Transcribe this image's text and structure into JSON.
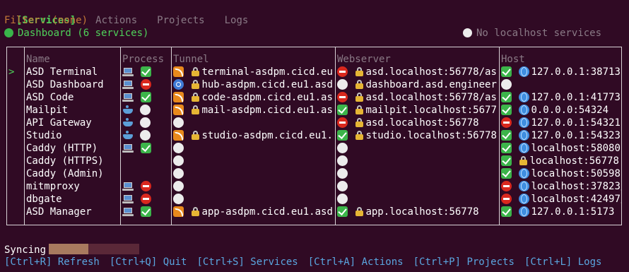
{
  "nav": {
    "tabs": [
      "[Services]",
      "Actions",
      "Projects",
      "Logs"
    ]
  },
  "filter": {
    "text": "Filter: (none)"
  },
  "project": {
    "label": "Dashboard (6 services)"
  },
  "localhost": {
    "label": "No localhost services"
  },
  "table": {
    "headers": {
      "name": "Name",
      "process": "Process",
      "tunnel": "Tunnel",
      "webserver": "Webserver",
      "host": "Host"
    },
    "selected_marker": ">",
    "rows": [
      {
        "name": "ASD Terminal",
        "tunnel": "terminal-asdpm.cicd.eu…",
        "webserver": "asd.localhost:56778/as…",
        "host": "127.0.0.1:38713"
      },
      {
        "name": "ASD Dashboard",
        "tunnel": "hub-asdpm.cicd.eu1.asd…",
        "webserver": "dashboard.asd.engineer…",
        "host": ""
      },
      {
        "name": "ASD Code",
        "tunnel": "code-asdpm.cicd.eu1.as…",
        "webserver": "asd.localhost:56778/as…",
        "host": "127.0.0.1:41773"
      },
      {
        "name": "Mailpit",
        "tunnel": "mail-asdpm.cicd.eu1.as…",
        "webserver": "mailpit.localhost:56778",
        "host": "0.0.0.0:54324"
      },
      {
        "name": "API Gateway",
        "tunnel": "",
        "webserver": "asd.localhost:56778",
        "host": "127.0.0.1:54321"
      },
      {
        "name": "Studio",
        "tunnel": "studio-asdpm.cicd.eu1.…",
        "webserver": "studio.localhost:56778",
        "host": "127.0.0.1:54323"
      },
      {
        "name": "Caddy (HTTP)",
        "tunnel": "",
        "webserver": "",
        "host": "localhost:58080"
      },
      {
        "name": "Caddy (HTTPS)",
        "tunnel": "",
        "webserver": "",
        "host": "localhost:56778"
      },
      {
        "name": "Caddy (Admin)",
        "tunnel": "",
        "webserver": "",
        "host": "localhost:50598"
      },
      {
        "name": "mitmproxy",
        "tunnel": "",
        "webserver": "",
        "host": "localhost:37823/"
      },
      {
        "name": "dbgate",
        "tunnel": "",
        "webserver": "",
        "host": "localhost:42497/"
      },
      {
        "name": "ASD Manager",
        "tunnel": "app-asdpm.cicd.eu1.asd…",
        "webserver": "app.localhost:56778",
        "host": "127.0.0.1:5173"
      }
    ]
  },
  "sync": {
    "label": "Syncing",
    "progress": 0.44
  },
  "footer": {
    "shortcuts": [
      "[Ctrl+R] Refresh",
      "[Ctrl+Q] Quit",
      "[Ctrl+S] Services",
      "[Ctrl+A] Actions",
      "[Ctrl+P] Projects",
      "[Ctrl+L] Logs"
    ]
  },
  "colors": {
    "background": "#300a24",
    "accent": "#4fd25a",
    "filter": "#c67a38",
    "footer": "#5aa6e0"
  }
}
